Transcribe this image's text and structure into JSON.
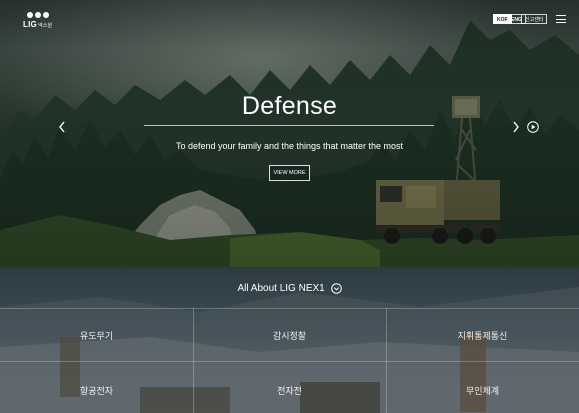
{
  "header": {
    "logo_text": "LIG",
    "logo_sub": "넥스원",
    "lang_kor": "KOR",
    "lang_eng": "ENG",
    "lang_pr": "신고센터",
    "menu_icon": "hamburger-icon"
  },
  "hero": {
    "title": "Defense",
    "subtitle": "To defend your family and the things that matter the most",
    "cta_label": "VIEW MORE",
    "prev_icon": "chevron-left-icon",
    "next_icon": "chevron-right-icon",
    "play_icon": "play-icon"
  },
  "section": {
    "about_label": "All About LIG NEX1",
    "about_icon": "chevron-down-circle-icon",
    "categories": [
      "유도무기",
      "감시정찰",
      "지휘통제통신",
      "항공전자",
      "전자전",
      "무인체계"
    ]
  },
  "colors": {
    "hero_dark": "#1a2a1d",
    "forest": "#2b4a2f",
    "accent_white": "#ffffff"
  }
}
